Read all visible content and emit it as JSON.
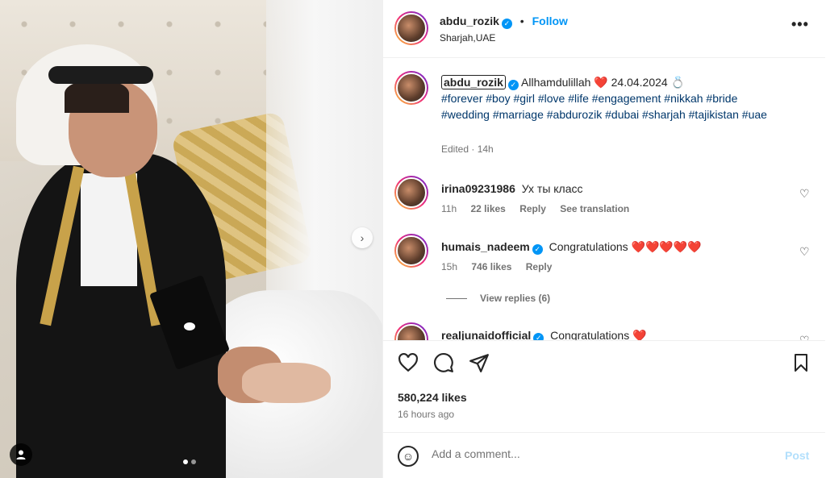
{
  "post": {
    "username": "abdu_rozik",
    "verified_glyph": "✓",
    "separator": "•",
    "follow_label": "Follow",
    "location": "Sharjah,UAE",
    "more_glyph": "•••"
  },
  "caption": {
    "username": "abdu_rozik",
    "text": "Allhamdulillah ❤️ 24.04.2024 💍",
    "hashtags": "#forever #boy #girl #love #life #engagement #nikkah #bride #wedding #marriage #abdurozik #dubai #sharjah #tajikistan #uae",
    "edited": "Edited · 14h"
  },
  "comments": [
    {
      "username": "irina09231986",
      "verified": false,
      "text": "Ух ты класс",
      "time": "11h",
      "likes": "22 likes",
      "reply": "Reply",
      "translate": "See translation"
    },
    {
      "username": "humais_nadeem",
      "verified": true,
      "text": "Congratulations ❤️❤️❤️❤️❤️",
      "time": "15h",
      "likes": "746 likes",
      "reply": "Reply",
      "view_replies": "View replies (6)"
    },
    {
      "username": "realjunaidofficial",
      "verified": true,
      "text": "Congratulations ❤️"
    }
  ],
  "actions": {
    "likes": "580,224 likes",
    "time_ago": "16 hours ago"
  },
  "composer": {
    "placeholder": "Add a comment...",
    "post_label": "Post",
    "emoji_glyph": "☺"
  },
  "media": {
    "next_glyph": "›",
    "user_tag_icon": "user-icon",
    "carousel_count": 2,
    "carousel_active": 0
  },
  "icons": {
    "heart": "♡",
    "comment": "◯",
    "share": "➤",
    "save": "🔖"
  },
  "colors": {
    "accent": "#0095f6",
    "hashtag": "#00376b",
    "muted": "#737373",
    "heart_red": "#ed4956"
  }
}
